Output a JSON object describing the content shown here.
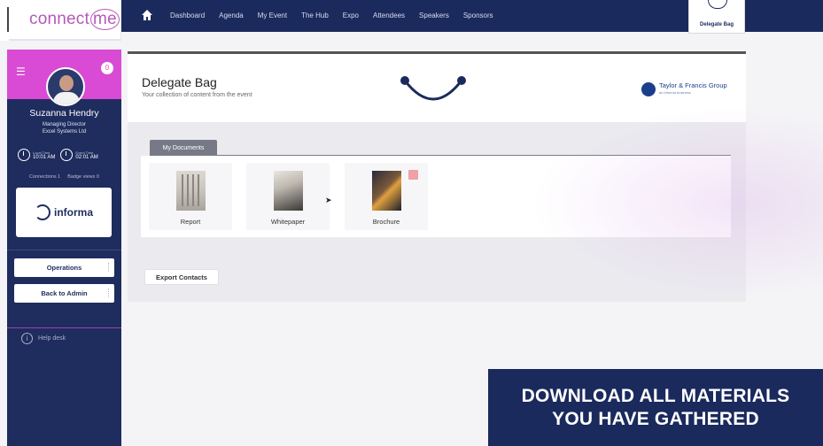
{
  "logo": {
    "text_main": "connect",
    "text_me": "me"
  },
  "nav": {
    "items": [
      "Dashboard",
      "Agenda",
      "My Event",
      "The Hub",
      "Expo",
      "Attendees",
      "Speakers",
      "Sponsors"
    ],
    "bag_label": "Delegate Bag"
  },
  "sidebar": {
    "notification_count": "0",
    "user": {
      "name": "Suzanna Hendry",
      "role": "Managing Director",
      "company": "Excel Systems Ltd"
    },
    "times": [
      {
        "label": "Local Time",
        "value": "10:01 AM"
      },
      {
        "label": "Event Time",
        "value": "02:01 AM"
      }
    ],
    "stats": {
      "connections": "Connections 1",
      "badge_views": "Badge views 0"
    },
    "sponsor": "informa",
    "buttons": {
      "operations": "Operations",
      "back_to_admin": "Back to Admin"
    },
    "help": "Help desk"
  },
  "main": {
    "title": "Delegate Bag",
    "subtitle": "Your collection of content from the event",
    "partner": {
      "name": "Taylor & Francis Group",
      "sub": "an informa business"
    },
    "tab": "My Documents",
    "documents": [
      {
        "label": "Report",
        "icon": "report-thumbnail"
      },
      {
        "label": "Whitepaper",
        "icon": "whitepaper-thumbnail"
      },
      {
        "label": "Brochure",
        "icon": "brochure-thumbnail"
      }
    ],
    "export_label": "Export Contacts"
  },
  "caption": {
    "line1": "DOWNLOAD ALL MATERIALS",
    "line2": "YOU HAVE GATHERED"
  },
  "colors": {
    "navy": "#1b2a5c",
    "magenta": "#d94bd4",
    "brand": "#b35ab8"
  }
}
